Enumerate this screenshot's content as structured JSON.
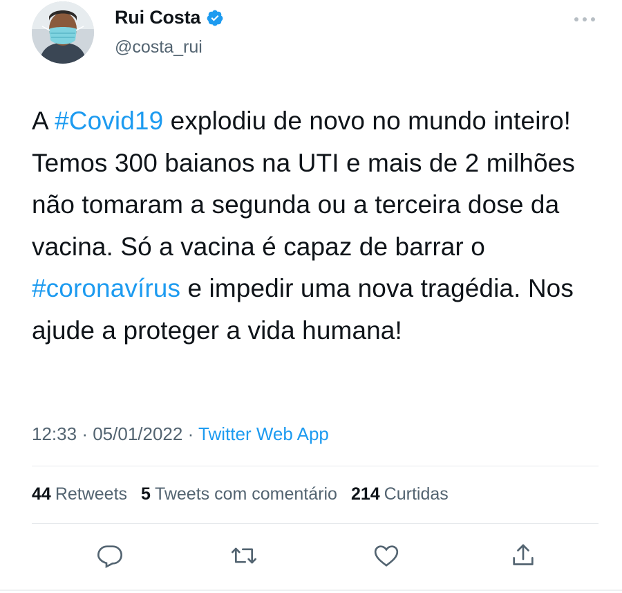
{
  "author": {
    "display_name": "Rui Costa",
    "handle": "@costa_rui",
    "verified": true,
    "avatar_icon": "avatar-photo",
    "verified_icon": "verified-badge-icon",
    "more_icon": "more-options-icon"
  },
  "tweet": {
    "segments": [
      {
        "text": "A ",
        "type": "plain"
      },
      {
        "text": "#Covid19",
        "type": "hashtag"
      },
      {
        "text": " explodiu de novo no mundo inteiro! Temos 300 baianos na UTI e mais de 2 milhões não tomaram a segunda ou a terceira dose da vacina. Só a vacina é capaz de barrar o ",
        "type": "plain"
      },
      {
        "text": "#coronavírus",
        "type": "hashtag"
      },
      {
        "text": " e impedir uma nova tragédia. Nos ajude a proteger a vida humana!",
        "type": "plain"
      }
    ],
    "time": "12:33",
    "date": "05/01/2022",
    "separator": "·",
    "source": "Twitter Web App"
  },
  "stats": {
    "retweets_count": "44",
    "retweets_label": "Retweets",
    "quotes_count": "5",
    "quotes_label": "Tweets com comentário",
    "likes_count": "214",
    "likes_label": "Curtidas"
  },
  "actions": [
    {
      "name": "reply",
      "icon": "reply-icon"
    },
    {
      "name": "retweet",
      "icon": "retweet-icon"
    },
    {
      "name": "like",
      "icon": "like-icon"
    },
    {
      "name": "share",
      "icon": "share-icon"
    }
  ],
  "colors": {
    "accent": "#1d9bf0",
    "text": "#0f1419",
    "secondary": "#536471",
    "divider": "#e6e9ec"
  }
}
